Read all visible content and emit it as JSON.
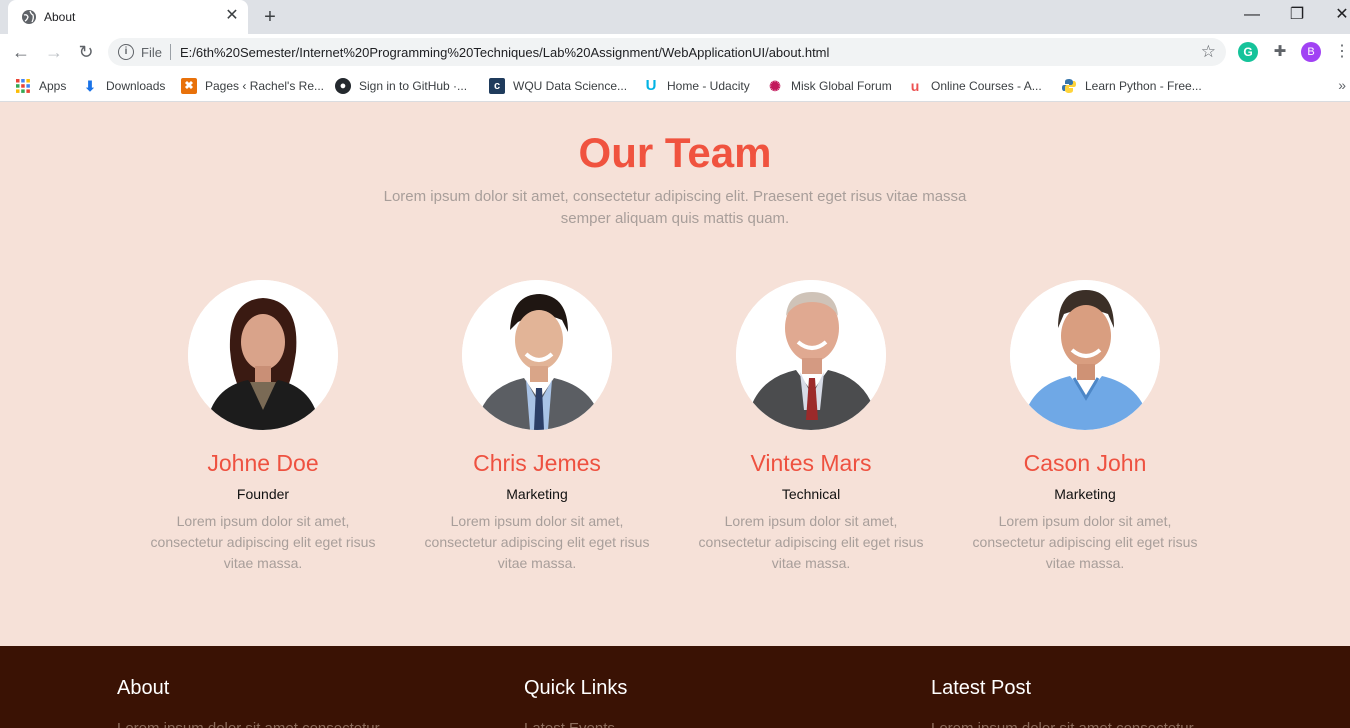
{
  "browser": {
    "tab": {
      "title": "About",
      "close": "✕"
    },
    "new_tab": "+",
    "window_controls": {
      "minimize": "—",
      "restore": "❐",
      "close": "✕"
    },
    "nav": {
      "back": "←",
      "forward": "→",
      "reload": "↻"
    },
    "address": {
      "scheme_label": "File",
      "url": "E:/6th%20Semester/Internet%20Programming%20Techniques/Lab%20Assignment/WebApplicationUI/about.html"
    },
    "avatar_letter": "B",
    "bookmarks": [
      {
        "label": "Apps",
        "icon": "apps-grid-icon",
        "color": "#4285f4"
      },
      {
        "label": "Downloads",
        "icon": "download-arrow-icon",
        "color": "#1a73e8"
      },
      {
        "label": "Pages ‹ Rachel's Re...",
        "icon": "pages-icon",
        "color": "#e8710a"
      },
      {
        "label": "Sign in to GitHub ·...",
        "icon": "github-icon",
        "color": "#24292e"
      },
      {
        "label": "WQU Data Science...",
        "icon": "wqu-icon",
        "color": "#1f3b5c"
      },
      {
        "label": "Home - Udacity",
        "icon": "udacity-icon",
        "color": "#02b3e4"
      },
      {
        "label": "Misk Global Forum",
        "icon": "misk-icon",
        "color": "#c2185b"
      },
      {
        "label": "Online Courses - A...",
        "icon": "udemy-icon",
        "color": "#ec5252"
      },
      {
        "label": "Learn Python - Free...",
        "icon": "python-icon",
        "color": "#3776ab"
      }
    ],
    "bookmarks_more": "»"
  },
  "team": {
    "title": "Our Team",
    "intro": "Lorem ipsum dolor sit amet, consectetur adipiscing elit. Praesent eget risus vitae massa semper aliquam quis mattis quam.",
    "members": [
      {
        "name": "Johne Doe",
        "role": "Founder",
        "bio": "Lorem ipsum dolor sit amet, consectetur adipiscing elit eget risus vitae massa."
      },
      {
        "name": "Chris Jemes",
        "role": "Marketing",
        "bio": "Lorem ipsum dolor sit amet, consectetur adipiscing elit eget risus vitae massa."
      },
      {
        "name": "Vintes Mars",
        "role": "Technical",
        "bio": "Lorem ipsum dolor sit amet, consectetur adipiscing elit eget risus vitae massa."
      },
      {
        "name": "Cason John",
        "role": "Marketing",
        "bio": "Lorem ipsum dolor sit amet, consectetur adipiscing elit eget risus vitae massa."
      }
    ]
  },
  "footer": {
    "about": {
      "heading": "About",
      "text": "Lorem ipsum dolor sit amet consectetur"
    },
    "quick_links": {
      "heading": "Quick Links",
      "text": "Latest Events"
    },
    "latest_post": {
      "heading": "Latest Post",
      "text": "Lorem ipsum dolor sit amet consectetur"
    }
  },
  "colors": {
    "accent": "#f0533f",
    "page_bg": "#f6e1d8",
    "footer_bg": "#3a1204"
  }
}
